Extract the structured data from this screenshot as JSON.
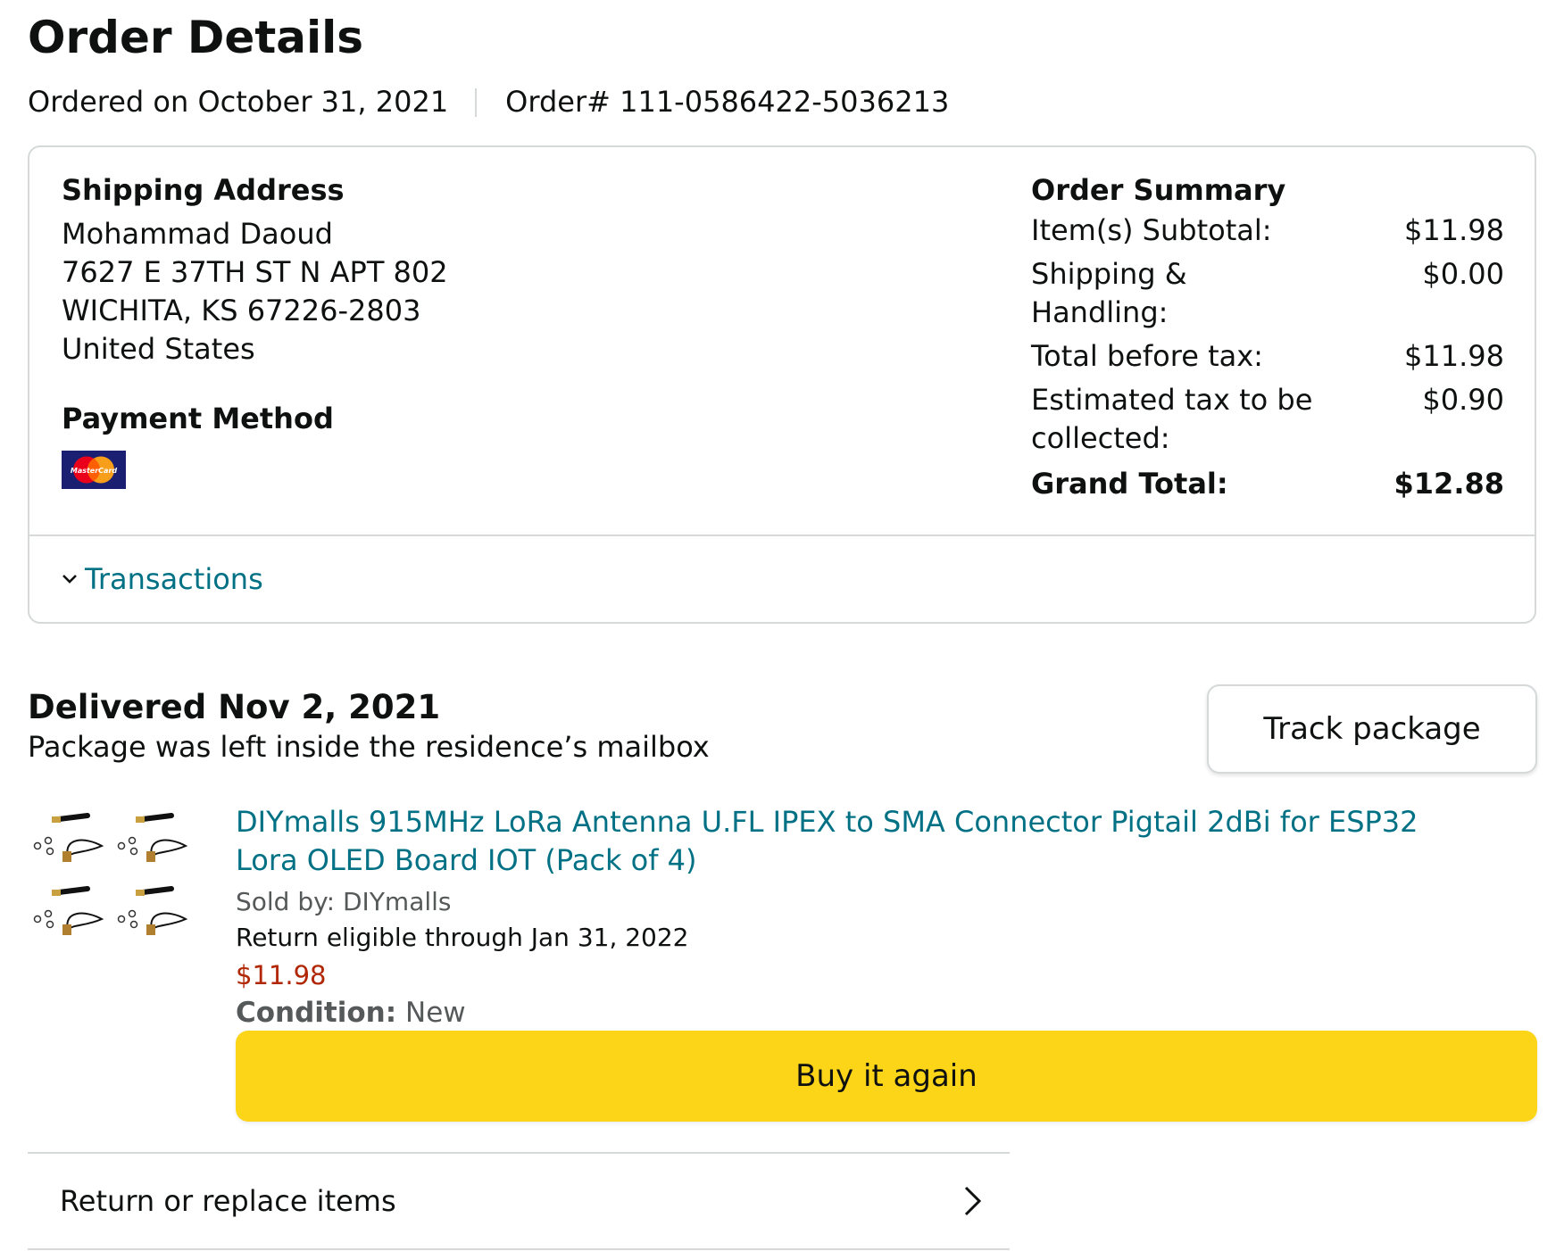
{
  "page_title": "Order Details",
  "order_meta": {
    "ordered_on": "Ordered on October 31, 2021",
    "order_number": "Order# 111-0586422-5036213"
  },
  "shipping": {
    "heading": "Shipping Address",
    "lines": [
      "Mohammad Daoud",
      "7627 E 37TH ST N APT 802",
      "WICHITA, KS 67226-2803",
      "United States"
    ]
  },
  "payment": {
    "heading": "Payment Method",
    "card_icon": "mastercard-icon",
    "card_logo_text": "MasterCard"
  },
  "summary": {
    "heading": "Order Summary",
    "rows": [
      {
        "label": "Item(s) Subtotal:",
        "value": "$11.98"
      },
      {
        "label": "Shipping & Handling:",
        "value": "$0.00"
      },
      {
        "label": "Total before tax:",
        "value": "$11.98"
      },
      {
        "label": "Estimated tax to be collected:",
        "value": "$0.90"
      }
    ],
    "grand_total": {
      "label": "Grand Total:",
      "value": "$12.88"
    }
  },
  "transactions": {
    "label": "Transactions",
    "icon": "chevron-down-icon"
  },
  "delivery": {
    "status": "Delivered Nov 2, 2021",
    "note": "Package was left inside the residence’s mailbox",
    "track_button": "Track package"
  },
  "item": {
    "title": "DIYmalls 915MHz LoRa Antenna U.FL IPEX to SMA Connector Pigtail 2dBi for ESP32 Lora OLED Board IOT (Pack of 4)",
    "sold_by": "Sold by: DIYmalls",
    "return_eligibility": "Return eligible through Jan 31, 2022",
    "price": "$11.98",
    "condition_label": "Condition:",
    "condition_value": "New",
    "buy_again_button": "Buy it again",
    "thumbnail_icon": "antenna-pack-icon"
  },
  "return_row": {
    "label": "Return or replace items",
    "icon": "chevron-right-icon"
  },
  "colors": {
    "link": "#007185",
    "price": "#b12704",
    "buy_button": "#fcd518",
    "border": "#d5d9d9"
  }
}
